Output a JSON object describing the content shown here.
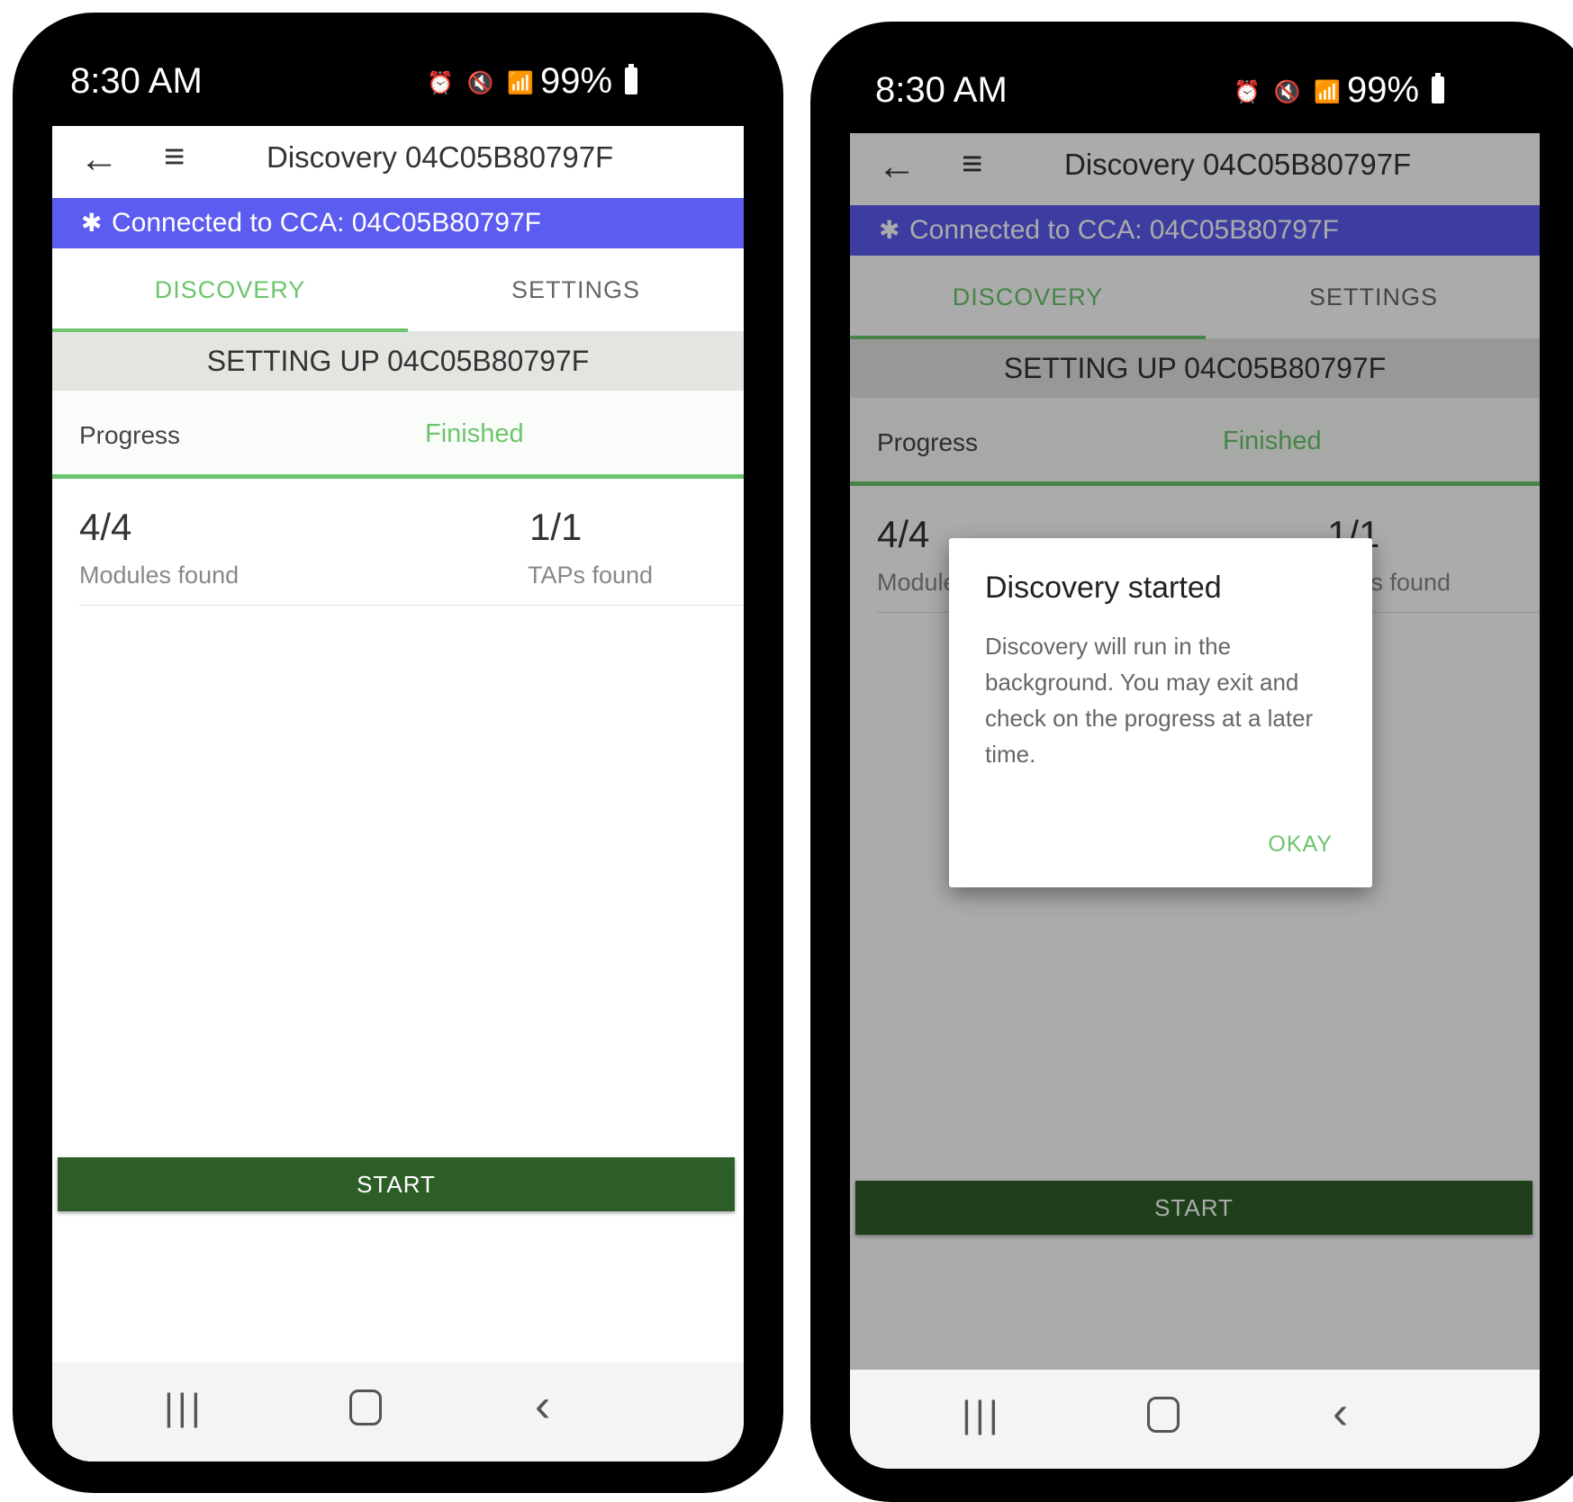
{
  "status": {
    "time": "8:30 AM",
    "battery": "99%",
    "icons": "⏰ 🔇 📶"
  },
  "appbar": {
    "title": "Discovery 04C05B80797F",
    "back_icon": "←",
    "menu_icon": "≡"
  },
  "connection": {
    "bt_icon": "✱",
    "text": "Connected to CCA: 04C05B80797F",
    "color": "#5c5cf0"
  },
  "tabs": [
    {
      "label": "DISCOVERY",
      "active": true
    },
    {
      "label": "SETTINGS",
      "active": false
    }
  ],
  "setup": {
    "text": "SETTING UP 04C05B80797F"
  },
  "progress": {
    "label": "Progress",
    "status": "Finished",
    "fraction": 1.0
  },
  "counts": {
    "modules": {
      "value": "4/4",
      "label": "Modules found"
    },
    "taps": {
      "value": "1/1",
      "label": "TAPs found"
    }
  },
  "start_button": {
    "label": "START"
  },
  "navbar": {
    "recent_icon": "|||",
    "back_icon": "‹"
  },
  "dialog": {
    "title": "Discovery started",
    "message": "Discovery will run in the background. You may exit and check on the progress at a later time.",
    "ok_label": "OKAY"
  },
  "colors": {
    "accent_green": "#6cc56c",
    "start_green": "#2e5e28"
  }
}
